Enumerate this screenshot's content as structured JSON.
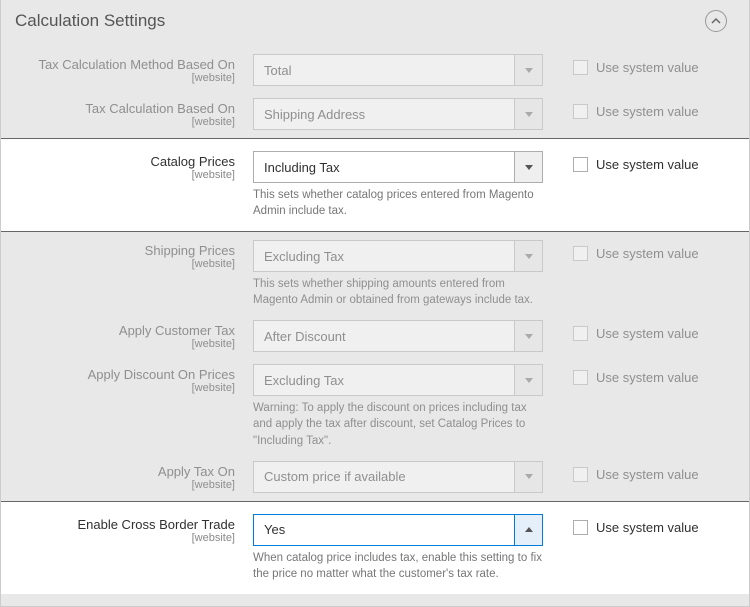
{
  "section": {
    "title": "Calculation Settings"
  },
  "common": {
    "scope": "[website]",
    "use_system_value": "Use system value"
  },
  "fields": {
    "method": {
      "label": "Tax Calculation Method Based On",
      "value": "Total"
    },
    "based_on": {
      "label": "Tax Calculation Based On",
      "value": "Shipping Address"
    },
    "catalog": {
      "label": "Catalog Prices",
      "value": "Including Tax",
      "hint": "This sets whether catalog prices entered from Magento Admin include tax."
    },
    "shipping": {
      "label": "Shipping Prices",
      "value": "Excluding Tax",
      "hint": "This sets whether shipping amounts entered from Magento Admin or obtained from gateways include tax."
    },
    "customer_tax": {
      "label": "Apply Customer Tax",
      "value": "After Discount"
    },
    "discount": {
      "label": "Apply Discount On Prices",
      "value": "Excluding Tax",
      "hint": "Warning: To apply the discount on prices including tax and apply the tax after discount, set Catalog Prices to \"Including Tax\"."
    },
    "apply_on": {
      "label": "Apply Tax On",
      "value": "Custom price if available"
    },
    "cross_border": {
      "label": "Enable Cross Border Trade",
      "value": "Yes",
      "hint": "When catalog price includes tax, enable this setting to fix the price no matter what the customer's tax rate."
    }
  }
}
